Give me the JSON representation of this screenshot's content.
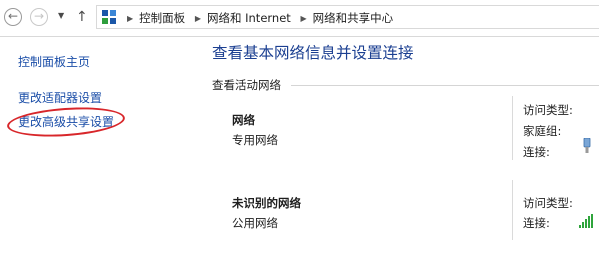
{
  "address_bar": {
    "back_glyph": "←",
    "forward_glyph": "→",
    "recent_glyph": "▼",
    "up_glyph": "↑",
    "breadcrumbs": [
      "控制面板",
      "网络和 Internet",
      "网络和共享中心"
    ],
    "separator_glyph": "▶"
  },
  "sidebar": {
    "items": [
      {
        "label": "控制面板主页"
      },
      {
        "label": "更改适配器设置"
      },
      {
        "label": "更改高级共享设置"
      }
    ]
  },
  "main": {
    "title": "查看基本网络信息并设置连接",
    "active_section": "查看活动网络",
    "networks": [
      {
        "name": "网络",
        "type": "专用网络",
        "props": [
          {
            "label": "访问类型:"
          },
          {
            "label": "家庭组:"
          },
          {
            "label": "连接:",
            "icon": "ethernet-icon"
          }
        ]
      },
      {
        "name": "未识别的网络",
        "type": "公用网络",
        "props": [
          {
            "label": "访问类型:"
          },
          {
            "label": "连接:",
            "icon": "wifi-signal-icon"
          }
        ]
      }
    ]
  },
  "colors": {
    "link": "#1b4ea8",
    "title": "#1b3f91",
    "annotation": "#d8262a",
    "signal": "#2fa43c"
  }
}
